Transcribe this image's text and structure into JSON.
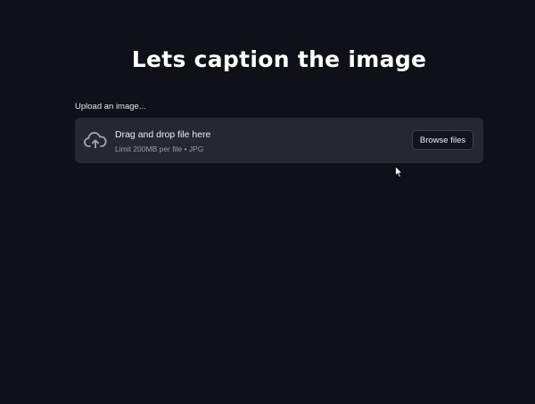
{
  "page": {
    "title": "Lets caption the image"
  },
  "uploader": {
    "label": "Upload an image...",
    "drag_text": "Drag and drop file here",
    "limit_text": "Limit 200MB per file • JPG",
    "browse_label": "Browse files",
    "icon": "cloud-upload-icon"
  },
  "colors": {
    "background": "#0e1117",
    "dropzone": "#262730",
    "text": "#ffffff"
  }
}
